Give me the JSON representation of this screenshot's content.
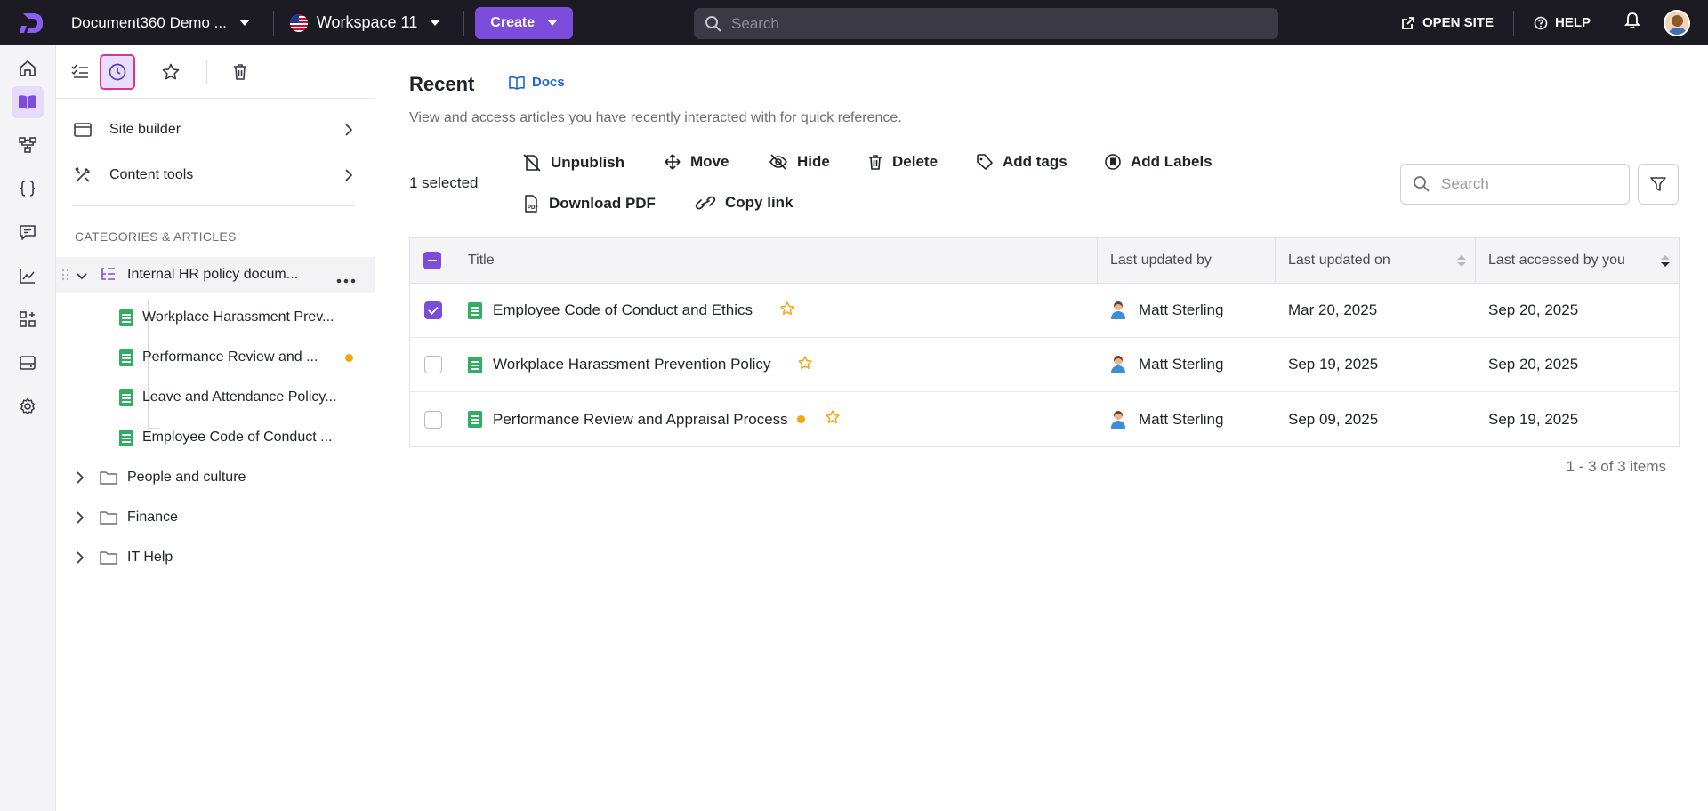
{
  "topbar": {
    "project_name": "Document360 Demo ...",
    "workspace": "Workspace 11",
    "create_label": "Create",
    "search_placeholder": "Search",
    "open_site_label": "OPEN SITE",
    "help_label": "HELP"
  },
  "rail": {
    "icons": [
      "home-icon",
      "book-icon",
      "hierarchy-icon",
      "code-braces-icon",
      "comment-icon",
      "analytics-icon",
      "apps-add-icon",
      "drive-icon",
      "settings-icon"
    ]
  },
  "sidebar": {
    "site_builder": "Site builder",
    "content_tools": "Content tools",
    "section_heading": "CATEGORIES & ARTICLES",
    "root_category": "Internal HR policy docum...",
    "articles": [
      {
        "label": "Workplace Harassment Prev...",
        "dot": false
      },
      {
        "label": "Performance Review and ...",
        "dot": true
      },
      {
        "label": "Leave and Attendance Policy...",
        "dot": false
      },
      {
        "label": "Employee Code of Conduct ...",
        "dot": false
      }
    ],
    "folders": [
      "People and culture",
      "Finance",
      "IT Help"
    ]
  },
  "main": {
    "title": "Recent",
    "docs_link": "Docs",
    "subtitle": "View and access articles you have recently interacted with for quick reference.",
    "selected_count": "1 selected",
    "actions": {
      "unpublish": "Unpublish",
      "move": "Move",
      "hide": "Hide",
      "delete": "Delete",
      "add_tags": "Add tags",
      "add_labels": "Add Labels",
      "download_pdf": "Download PDF",
      "copy_link": "Copy link"
    },
    "search_placeholder": "Search",
    "table": {
      "headers": {
        "title": "Title",
        "updated_by": "Last updated by",
        "updated_on": "Last updated on",
        "accessed": "Last accessed by you"
      },
      "rows": [
        {
          "title": "Employee Code of Conduct and Ethics",
          "updated_by": "Matt Sterling",
          "updated_on": "Mar 20, 2025",
          "accessed": "Sep 20, 2025",
          "checked": true,
          "dot": false
        },
        {
          "title": "Workplace Harassment Prevention Policy",
          "updated_by": "Matt Sterling",
          "updated_on": "Sep 19, 2025",
          "accessed": "Sep 20, 2025",
          "checked": false,
          "dot": false
        },
        {
          "title": "Performance Review and Appraisal Process",
          "updated_by": "Matt Sterling",
          "updated_on": "Sep 09, 2025",
          "accessed": "Sep 19, 2025",
          "checked": false,
          "dot": true
        }
      ]
    },
    "pagination": "1 - 3 of 3 items"
  },
  "colors": {
    "accent": "#7c4ddb",
    "topbar_bg": "#1c1b23",
    "doc_green": "#2eaf62",
    "status_dot": "#f5a50a",
    "star": "#f5a50a",
    "link_blue": "#1c64d9"
  }
}
